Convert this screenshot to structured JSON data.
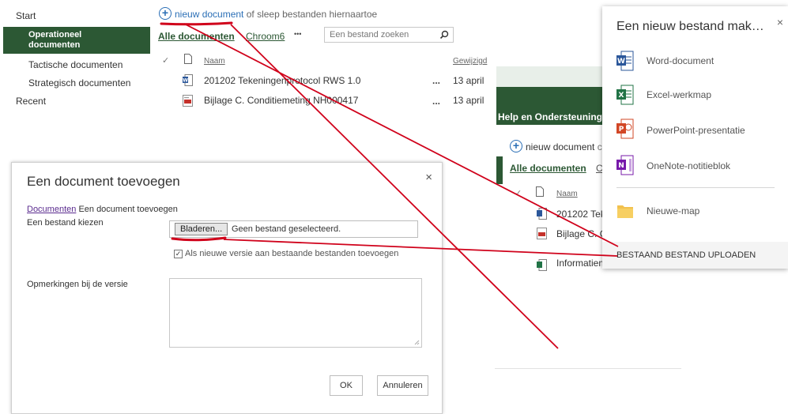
{
  "nav": {
    "start": "Start",
    "operationeel": "Operationeel documenten",
    "tactische": "Tactische documenten",
    "strategisch": "Strategisch documenten",
    "recent": "Recent"
  },
  "command": {
    "new_document": "nieuw document",
    "drag_hint": "of sleep bestanden hiernaartoe"
  },
  "views": {
    "all_documents": "Alle documenten",
    "chroom": "Chroom6",
    "more": "•••"
  },
  "search": {
    "placeholder": "Een bestand zoeken"
  },
  "columns": {
    "name": "Naam",
    "modified": "Gewijzigd"
  },
  "rows": [
    {
      "name": "201202 Tekeningenprotocol RWS 1.0",
      "modified": "13 april",
      "icon": "word-doc-icon"
    },
    {
      "name": "Bijlage C. Conditiemeting NH000417",
      "modified": "13 april",
      "icon": "pdf-doc-icon"
    }
  ],
  "background_panel": {
    "help": "Help en Ondersteuning",
    "new_document": "nieuw document",
    "new_document_tail": "c",
    "all_documents": "Alle documenten",
    "view_c": "C",
    "name_col": "Naam",
    "row1": "201202 Teke",
    "row2": "Bijlage C. C",
    "row3": "Informatiem"
  },
  "dialog": {
    "title": "Een document toevoegen",
    "close": "×",
    "breadcrumb_link": "Documenten",
    "breadcrumb_rest": "Een document toevoegen",
    "choose_file_label": "Een bestand kiezen",
    "browse": "Bladeren...",
    "no_file": "Geen bestand geselecteerd.",
    "add_as_version": "Als nieuwe versie aan bestaande bestanden toevoegen",
    "version_comments": "Opmerkingen bij de versie",
    "ok": "OK",
    "cancel": "Annuleren"
  },
  "flyout": {
    "title": "Een nieuw bestand mak…",
    "close": "×",
    "items": [
      {
        "label": "Word-document",
        "icon": "word-icon",
        "badge": "W",
        "color": "#2b579a"
      },
      {
        "label": "Excel-werkmap",
        "icon": "excel-icon",
        "badge": "X",
        "color": "#217346"
      },
      {
        "label": "PowerPoint-presentatie",
        "icon": "powerpoint-icon",
        "badge": "P",
        "color": "#d24726"
      },
      {
        "label": "OneNote-notitieblok",
        "icon": "onenote-icon",
        "badge": "N",
        "color": "#7719aa"
      },
      {
        "label": "Nieuwe-map",
        "icon": "folder-icon",
        "badge": "",
        "color": "#f2c14e"
      }
    ],
    "upload": "BESTAAND BESTAND UPLOADEN"
  },
  "colors": {
    "accent_green": "#2c5834",
    "link_blue": "#2b6fb6",
    "annotation_red": "#d0021b"
  }
}
